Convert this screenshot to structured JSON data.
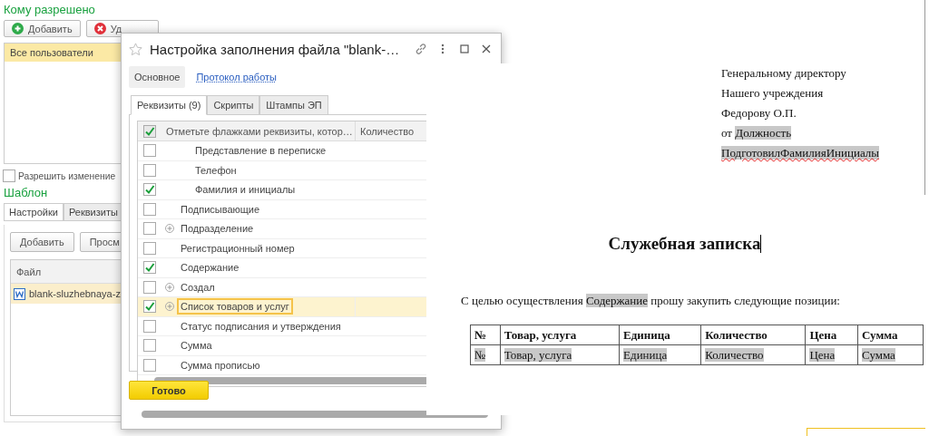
{
  "background_form": {
    "permissions_title": "Кому разрешено",
    "buttons": [
      {
        "label": "Добавить",
        "kind": "add"
      },
      {
        "label": "Уд",
        "kind": "delete"
      }
    ],
    "users": [
      {
        "label": "Все пользователи",
        "selected": true
      }
    ],
    "allow_change": {
      "label": "Разрешить изменение",
      "checked": false
    },
    "template_title": "Шаблон",
    "tabs": [
      {
        "label": "Настройки",
        "selected": true
      },
      {
        "label": "Реквизиты",
        "selected": false
      }
    ],
    "template_buttons": [
      "Добавить",
      "Просм"
    ],
    "files": {
      "columns": [
        "Файл"
      ],
      "rows": [
        {
          "name": "blank-sluzhebnaya-z",
          "selected": true
        }
      ]
    }
  },
  "dialog": {
    "title": "Настройка заполнения файла \"blank-…",
    "sections": [
      {
        "label": "Основное",
        "selected": true
      },
      {
        "label": "Протокол работы",
        "selected": false
      }
    ],
    "tabs": [
      {
        "label": "Реквизиты (9)",
        "selected": true
      },
      {
        "label": "Скрипты",
        "selected": false
      },
      {
        "label": "Штампы ЭП",
        "selected": false
      }
    ],
    "table": {
      "all_checked": true,
      "columns": [
        "Отметьте флажками реквизиты, котор…",
        "Количество"
      ],
      "rows": [
        {
          "children": [
            {
              "label": "Представление в переписке",
              "kind": "item",
              "checked": false,
              "selected": false
            },
            {
              "label": "Телефон",
              "kind": "item",
              "checked": false,
              "selected": false
            },
            {
              "label": "Фамилия и инициалы",
              "kind": "item",
              "checked": true,
              "selected": false
            }
          ]
        },
        {
          "label": "Подписывающие",
          "kind": "item",
          "checked": false,
          "selected": false
        },
        {
          "label": "Подразделение",
          "kind": "group",
          "checked": false,
          "selected": false
        },
        {
          "label": "Регистрационный номер",
          "kind": "item",
          "checked": false,
          "selected": false
        },
        {
          "label": "Содержание",
          "kind": "item",
          "checked": true,
          "selected": false
        },
        {
          "label": "Создал",
          "kind": "group",
          "checked": false,
          "selected": false
        },
        {
          "label": "Список товаров и услуг",
          "kind": "group",
          "checked": true,
          "selected": true
        },
        {
          "label": "Статус подписания и утверждения",
          "kind": "item",
          "checked": false,
          "selected": false
        },
        {
          "label": "Сумма",
          "kind": "item",
          "checked": false,
          "selected": false
        },
        {
          "label": "Сумма прописью",
          "kind": "item",
          "checked": false,
          "selected": false
        }
      ]
    },
    "done_button": "Готово"
  },
  "document": {
    "address": [
      {
        "segments": [
          {
            "text": "Генеральному директору",
            "field": false
          }
        ],
        "misspelled": false
      },
      {
        "segments": [
          {
            "text": "Нашего учреждения",
            "field": false
          }
        ],
        "misspelled": false
      },
      {
        "segments": [
          {
            "text": "Федорову О.П.",
            "field": false
          }
        ],
        "misspelled": false
      },
      {
        "segments": [
          {
            "text": "от ",
            "field": false
          },
          {
            "text": "Должность",
            "field": true
          }
        ],
        "misspelled": false
      },
      {
        "segments": [
          {
            "text": "ПодготовилФамилияИнициалы",
            "field": true
          }
        ],
        "misspelled": true
      }
    ],
    "title": "Служебная записка",
    "paragraph": [
      {
        "text": "С целью осуществления ",
        "field": false
      },
      {
        "text": "Содержание",
        "field": true
      },
      {
        "text": " прошу закупить следующие позиции:",
        "field": false
      }
    ],
    "table": {
      "header": [
        "№",
        "Товар, услуга",
        "Единица",
        "Количество",
        "Цена",
        "Сумма"
      ],
      "rows": [
        [
          {
            "text": "№",
            "field": true
          },
          {
            "text": "Товар, услуга",
            "field": true
          },
          {
            "text": "Единица",
            "field": true
          },
          {
            "text": "Количество",
            "field": true
          },
          {
            "text": "Цена",
            "field": true
          },
          {
            "text": "Сумма",
            "field": true
          }
        ]
      ]
    }
  }
}
